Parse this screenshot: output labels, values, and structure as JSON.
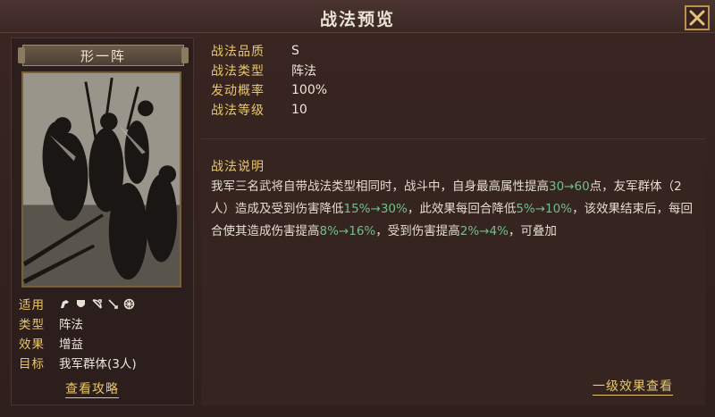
{
  "window": {
    "title": "战法预览"
  },
  "skill": {
    "name": "形一阵",
    "info": {
      "applicable_label": "适用",
      "type_label": "类型",
      "type_value": "阵法",
      "effect_label": "效果",
      "effect_value": "增益",
      "target_label": "目标",
      "target_value": "我军群体(3人)"
    },
    "applicable_icons": [
      "cavalry-icon",
      "shield-icon",
      "bow-icon",
      "spear-icon",
      "siege-icon"
    ],
    "guide_link": "查看攻略"
  },
  "stats": [
    {
      "key": "战法品质",
      "value": "S"
    },
    {
      "key": "战法类型",
      "value": "阵法"
    },
    {
      "key": "发动概率",
      "value": "100%"
    },
    {
      "key": "战法等级",
      "value": "10"
    }
  ],
  "description": {
    "title": "战法说明",
    "segments": [
      "我军三名武将自带战法类型相同时，战斗中，自身最高属性提高",
      "30→60",
      "点，友军群体（2人）造成及受到伤害降低",
      "15%→30%",
      "，此效果每回合降低",
      "5%→10%",
      "，该效果结束后，每回合使其造成伤害提高",
      "8%→16%",
      "，受到伤害提高",
      "2%→4%",
      "，可叠加"
    ]
  },
  "effect_link": "一级效果查看",
  "colors": {
    "gold": "#e8c76a",
    "highlight": "#6fc08a"
  }
}
